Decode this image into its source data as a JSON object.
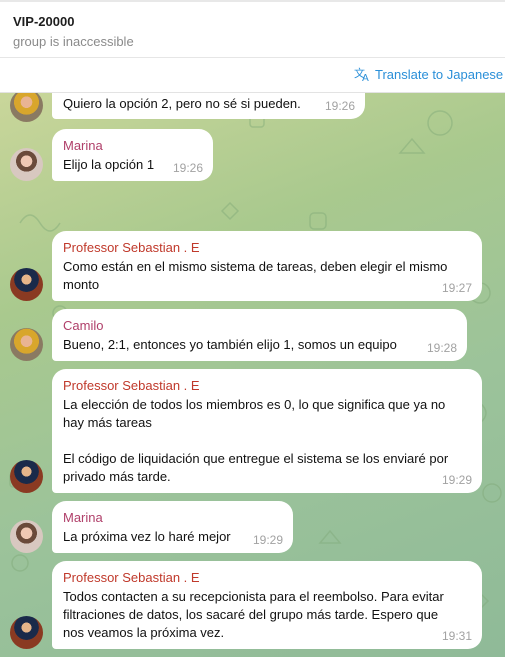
{
  "header": {
    "title": "VIP-20000",
    "subtitle": "group is inaccessible"
  },
  "translate": {
    "label": "Translate to Japanese",
    "icon": "translate-icon"
  },
  "colors": {
    "accent": "#2a8fd8",
    "sender_sebastian": "#c0392b",
    "sender_marina": "#b0406a",
    "sender_camilo": "#b0406a"
  },
  "messages": [
    {
      "sender": "",
      "text_lines": [
        "Quiero la opción 2, pero no sé si pueden."
      ],
      "time": "19:26"
    },
    {
      "sender": "Marina",
      "text_lines": [
        "Elijo la opción 1"
      ],
      "time": "19:26"
    },
    {
      "sender": "Professor Sebastian . E",
      "text_lines": [
        "Como están en el mismo sistema de tareas, deben elegir el mismo",
        "monto"
      ],
      "time": "19:27"
    },
    {
      "sender": "Camilo",
      "text_lines": [
        "Bueno, 2:1, entonces yo también elijo 1, somos un equipo"
      ],
      "time": "19:28"
    },
    {
      "sender": "Professor Sebastian . E",
      "text_lines": [
        "La elección de todos los miembros es 0, lo que significa que ya no",
        "hay más tareas",
        "El código de liquidación que entregue el sistema se los enviaré por",
        "privado más tarde."
      ],
      "time": "19:29"
    },
    {
      "sender": "Marina",
      "text_lines": [
        "La próxima vez lo haré mejor"
      ],
      "time": "19:29"
    },
    {
      "sender": "Professor Sebastian . E",
      "text_lines": [
        "Todos contacten a su recepcionista para el reembolso. Para evitar",
        "filtraciones de datos, los sacaré del grupo más tarde. Espero que",
        "nos veamos la próxima vez."
      ],
      "time": "19:31"
    }
  ]
}
